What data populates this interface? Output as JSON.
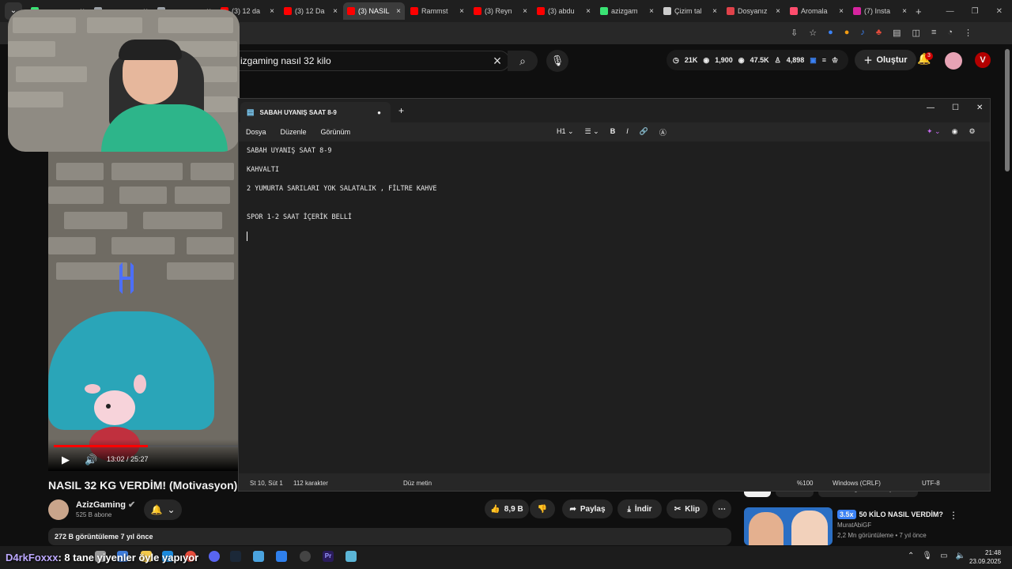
{
  "browser": {
    "tabs": [
      {
        "title": "",
        "color": "#3ae374",
        "active": false
      },
      {
        "title": "",
        "color": "#9aa0a6",
        "active": false
      },
      {
        "title": "",
        "color": "#9aa0a6",
        "active": false
      },
      {
        "title": "(3) 12 da",
        "color": "#ff0000",
        "active": false
      },
      {
        "title": "(3) 12 Da",
        "color": "#ff0000",
        "active": false
      },
      {
        "title": "(3) NASIL",
        "color": "#ff0000",
        "active": true
      },
      {
        "title": "Rammst",
        "color": "#ff0000",
        "active": false
      },
      {
        "title": "(3) Reyn",
        "color": "#ff0000",
        "active": false
      },
      {
        "title": "(3) abdu",
        "color": "#ff0000",
        "active": false
      },
      {
        "title": "azizgam",
        "color": "#3ae374",
        "active": false
      },
      {
        "title": "Çizim tal",
        "color": "#cccccc",
        "active": false
      },
      {
        "title": "Dosyanız",
        "color": "#e0424a",
        "active": false
      },
      {
        "title": "Aromala",
        "color": "#ff4d6d",
        "active": false
      },
      {
        "title": "(7) Insta",
        "color": "#d6249f",
        "active": false
      }
    ],
    "new_tab": "+"
  },
  "youtube": {
    "search_text": "izgaming nasıl 32 kilo",
    "stats": {
      "a": "21K",
      "b": "1,900",
      "c": "47.5K",
      "d": "4,898"
    },
    "create_label": "Oluştur",
    "notif_count": "3",
    "account_letter": "V",
    "time_display": "13:02 / 25:27",
    "progress": 0.51,
    "video_title": "NASIL 32 KG VERDİM! (Motivasyon)",
    "channel_name": "AzizGaming",
    "subscribers": "525 B abone",
    "likes": "8,9 B",
    "share_label": "Paylaş",
    "download_label": "İndir",
    "clip_label": "Klip",
    "views_line": "272 B görüntüleme  7 yıl önce",
    "chips": [
      "Tümü",
      "Yemekler",
      "AzizGaming tarafından yüklendi"
    ],
    "rec": {
      "speed": "3.5x",
      "title": "50 KİLO NASIL VERDİM?",
      "channel": "MuratAbiGF",
      "meta": "2,2 Mn görüntüleme • 7 yıl önce"
    }
  },
  "notepad": {
    "tab_title": "SABAH UYANIŞ SAAT 8-9",
    "menu": [
      "Dosya",
      "Düzenle",
      "Görünüm"
    ],
    "heading": "H1",
    "lines": [
      "SABAH UYANIŞ SAAT 8-9",
      "",
      "KAHVALTI",
      "",
      "2 YUMURTA SARILARI YOK SALATALIK , FİLTRE KAHVE",
      "",
      "",
      "SPOR 1-2 SAAT İÇERİK BELLİ",
      "",
      ""
    ],
    "status": {
      "position": "St 10, Süt 1",
      "chars": "112 karakter",
      "format": "Düz metin",
      "zoom": "%100",
      "eol": "Windows (CRLF)",
      "encoding": "UTF-8"
    }
  },
  "overlay_text": {
    "user": "D4rkFoxxx",
    "message": ": 8 tane yiyenler öyle yapıyor"
  },
  "clock": {
    "time": "21:48",
    "date": "23.09.2025"
  }
}
